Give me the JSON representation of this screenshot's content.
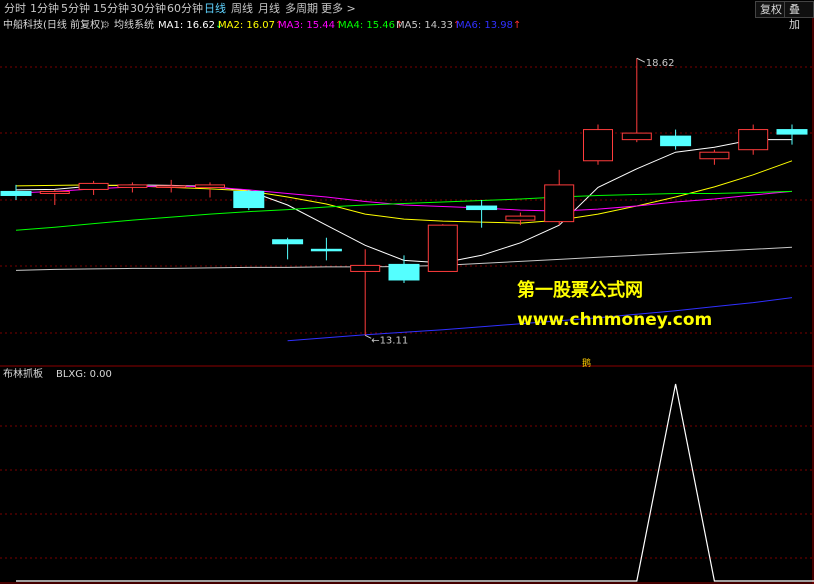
{
  "toolbar": {
    "periods": [
      {
        "label": "分时"
      },
      {
        "label": "1分钟"
      },
      {
        "label": "5分钟"
      },
      {
        "label": "15分钟"
      },
      {
        "label": "30分钟"
      },
      {
        "label": "60分钟"
      },
      {
        "label": "日线"
      },
      {
        "label": "周线"
      },
      {
        "label": "月线"
      },
      {
        "label": "多周期"
      },
      {
        "label": "更多 >"
      }
    ],
    "active_period": "日线",
    "restore_label": "复权",
    "overlay_label": "叠加"
  },
  "main_title": {
    "stock": "中船科技(日线 前复权)",
    "indicator": "均线系统",
    "ma": [
      {
        "label": "MA1: 16.62",
        "arrow": "↓",
        "color": "#ffffff"
      },
      {
        "label": "MA2: 16.07",
        "arrow": "↑",
        "color": "#ffff00"
      },
      {
        "label": "MA3: 15.44",
        "arrow": "↑",
        "color": "#ff00ff"
      },
      {
        "label": "MA4: 15.46",
        "arrow": "↑",
        "color": "#00ff00"
      },
      {
        "label": "MA5: 14.33",
        "arrow": "↑",
        "color": "#c8c8c8"
      },
      {
        "label": "MA6: 13.98",
        "arrow": "↑",
        "color": "#3030ff"
      }
    ]
  },
  "sub_title": {
    "indicator": "布林抓板",
    "value": "BLXG: 0.00"
  },
  "annotations": {
    "high_label": "18.62",
    "low_label": "13.11",
    "watermark_cn": "第一股票公式网",
    "watermark_url": "www.chnmoney.com",
    "tag": "鹅"
  },
  "chart_data": {
    "type": "candlestick",
    "price_range": [
      12.5,
      19.1
    ],
    "candles": [
      {
        "o": 15.89,
        "c": 15.97,
        "h": 16.1,
        "l": 15.8,
        "color": "cyan"
      },
      {
        "o": 15.97,
        "c": 15.93,
        "h": 16.0,
        "l": 15.7,
        "color": "red"
      },
      {
        "o": 16.01,
        "c": 16.13,
        "h": 16.18,
        "l": 15.9,
        "color": "red"
      },
      {
        "o": 16.05,
        "c": 16.1,
        "h": 16.15,
        "l": 15.95,
        "color": "red"
      },
      {
        "o": 16.08,
        "c": 16.06,
        "h": 16.2,
        "l": 15.95,
        "color": "red"
      },
      {
        "o": 16.1,
        "c": 16.05,
        "h": 16.15,
        "l": 15.85,
        "color": "red"
      },
      {
        "o": 15.97,
        "c": 15.65,
        "h": 16.0,
        "l": 15.6,
        "color": "cyan"
      },
      {
        "o": 15.01,
        "c": 14.93,
        "h": 15.05,
        "l": 14.62,
        "color": "cyan"
      },
      {
        "o": 14.82,
        "c": 14.79,
        "h": 15.05,
        "l": 14.6,
        "color": "cyan"
      },
      {
        "o": 14.5,
        "c": 14.38,
        "h": 14.82,
        "l": 13.11,
        "color": "red"
      },
      {
        "o": 14.52,
        "c": 14.21,
        "h": 14.7,
        "l": 14.15,
        "color": "cyan"
      },
      {
        "o": 14.38,
        "c": 15.3,
        "h": 15.32,
        "l": 14.38,
        "color": "red"
      },
      {
        "o": 15.68,
        "c": 15.61,
        "h": 15.8,
        "l": 15.25,
        "color": "cyan"
      },
      {
        "o": 15.4,
        "c": 15.48,
        "h": 15.55,
        "l": 15.3,
        "color": "red"
      },
      {
        "o": 15.37,
        "c": 16.1,
        "h": 16.4,
        "l": 15.3,
        "color": "red"
      },
      {
        "o": 16.58,
        "c": 17.2,
        "h": 17.3,
        "l": 16.5,
        "color": "red"
      },
      {
        "o": 17.0,
        "c": 17.13,
        "h": 18.62,
        "l": 16.95,
        "color": "red"
      },
      {
        "o": 17.07,
        "c": 16.88,
        "h": 17.2,
        "l": 16.8,
        "color": "cyan"
      },
      {
        "o": 16.62,
        "c": 16.75,
        "h": 16.8,
        "l": 16.5,
        "color": "red"
      },
      {
        "o": 16.8,
        "c": 17.2,
        "h": 17.3,
        "l": 16.7,
        "color": "red"
      },
      {
        "o": 17.11,
        "c": 17.2,
        "h": 17.3,
        "l": 16.9,
        "color": "cyan"
      }
    ],
    "ma_lines": [
      {
        "name": "MA1",
        "color": "#ffffff",
        "values": [
          16.0,
          16.01,
          16.08,
          16.1,
          16.09,
          16.07,
          15.98,
          15.7,
          15.3,
          14.9,
          14.6,
          14.55,
          14.7,
          14.95,
          15.3,
          16.05,
          16.42,
          16.75,
          16.85,
          17.0,
          17.0
        ]
      },
      {
        "name": "MA2",
        "color": "#ffff00",
        "values": [
          16.08,
          16.09,
          16.1,
          16.08,
          16.05,
          16.02,
          15.98,
          15.86,
          15.72,
          15.52,
          15.42,
          15.38,
          15.36,
          15.34,
          15.4,
          15.52,
          15.68,
          15.86,
          16.06,
          16.3,
          16.58
        ]
      },
      {
        "name": "MA3",
        "color": "#ff00ff",
        "values": [
          15.94,
          15.97,
          16.02,
          16.06,
          16.08,
          16.06,
          16.0,
          15.93,
          15.86,
          15.77,
          15.7,
          15.67,
          15.64,
          15.6,
          15.58,
          15.62,
          15.68,
          15.76,
          15.82,
          15.9,
          15.97
        ]
      },
      {
        "name": "MA4",
        "color": "#00ff00",
        "values": [
          15.2,
          15.26,
          15.33,
          15.4,
          15.46,
          15.52,
          15.57,
          15.61,
          15.66,
          15.7,
          15.73,
          15.76,
          15.79,
          15.82,
          15.86,
          15.89,
          15.91,
          15.93,
          15.93,
          15.95,
          15.97
        ]
      },
      {
        "name": "MA5",
        "color": "#c8c8c8",
        "values": [
          14.4,
          14.42,
          14.43,
          14.44,
          14.44,
          14.45,
          14.46,
          14.46,
          14.47,
          14.47,
          14.48,
          14.5,
          14.54,
          14.58,
          14.62,
          14.66,
          14.7,
          14.74,
          14.78,
          14.82,
          14.86
        ]
      },
      {
        "name": "MA6",
        "color": "#3030ff",
        "values": [
          null,
          null,
          null,
          null,
          null,
          null,
          null,
          13.0,
          13.06,
          13.12,
          13.17,
          13.22,
          13.28,
          13.34,
          13.4,
          13.46,
          13.53,
          13.6,
          13.68,
          13.76,
          13.86
        ]
      }
    ],
    "sub_indicator": {
      "name": "BLXG",
      "range": [
        0,
        1
      ],
      "x_points": [
        0,
        16,
        17,
        18,
        21
      ],
      "values": [
        0,
        0,
        1,
        0,
        0
      ]
    }
  }
}
